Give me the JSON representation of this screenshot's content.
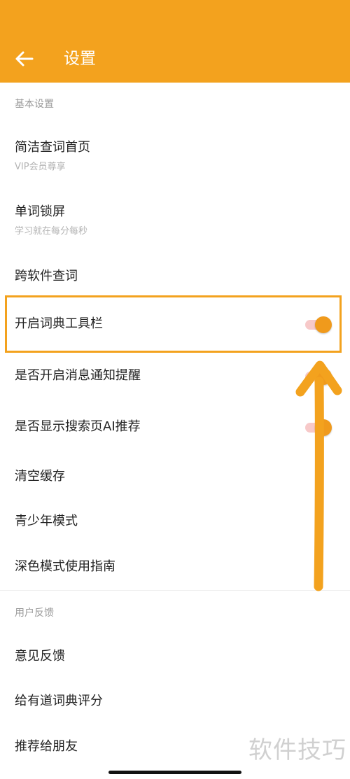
{
  "header": {
    "title": "设置",
    "back_icon": "arrow-left-icon"
  },
  "sections": {
    "basic": {
      "label": "基本设置",
      "items": [
        {
          "title": "简洁查词首页",
          "subtitle": "VIP会员尊享"
        },
        {
          "title": "单词锁屏",
          "subtitle": "学习就在每分每秒"
        },
        {
          "title": "跨软件查词"
        },
        {
          "title": "开启词典工具栏",
          "toggle_on": true
        },
        {
          "title": "是否开启消息通知提醒",
          "toggle_on": true
        },
        {
          "title": "是否显示搜索页AI推荐",
          "toggle_on": true
        },
        {
          "title": "清空缓存"
        },
        {
          "title": "青少年模式"
        },
        {
          "title": "深色模式使用指南"
        }
      ]
    },
    "feedback": {
      "label": "用户反馈",
      "items": [
        {
          "title": "意见反馈"
        },
        {
          "title": "给有道词典评分"
        },
        {
          "title": "推荐给朋友"
        }
      ]
    }
  },
  "watermark": "软件技巧",
  "colors": {
    "accent": "#f3a21e",
    "toggle_thumb": "#f09a1c",
    "toggle_track": "#f7c9c9",
    "annotation": "#f3a21e"
  }
}
